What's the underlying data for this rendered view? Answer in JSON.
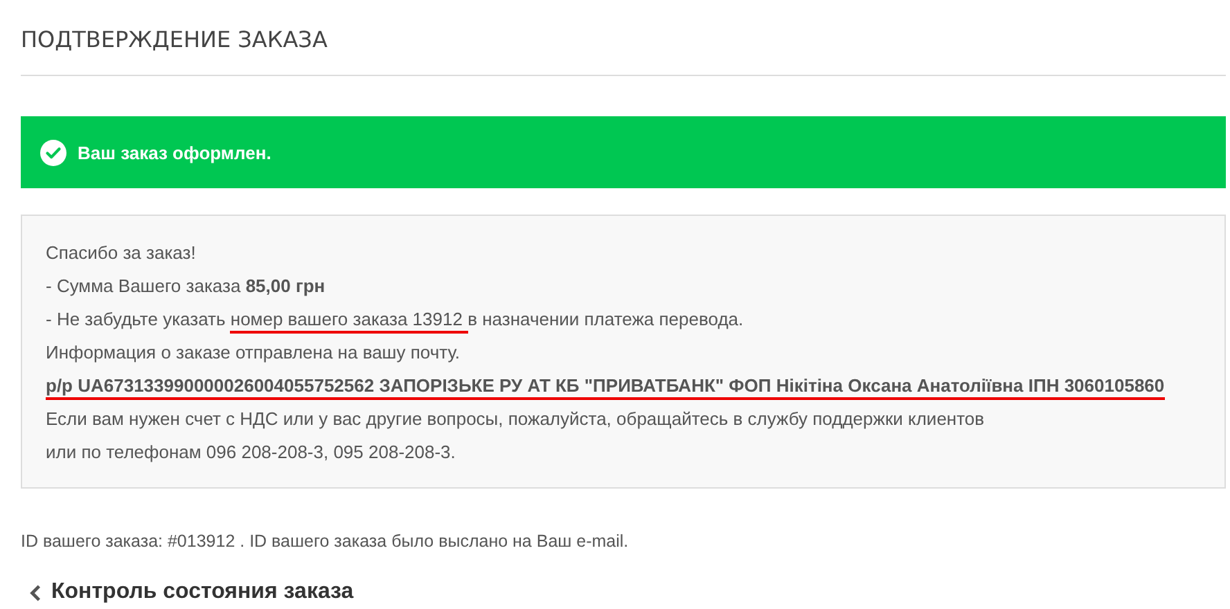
{
  "page_title": "ПОДТВЕРЖДЕНИЕ ЗАКАЗА",
  "alert": {
    "kind": "success",
    "text": "Ваш заказ оформлен."
  },
  "info_lines": [
    [
      {
        "text": "Спасибо за заказ!",
        "bold": false,
        "underlined": false
      }
    ],
    [
      {
        "text": "- Сумма Вашего заказа ",
        "bold": false,
        "underlined": false
      },
      {
        "text": "85,00 грн",
        "bold": true,
        "underlined": false
      }
    ],
    [
      {
        "text": "- Не забудьте указать ",
        "bold": false,
        "underlined": false
      },
      {
        "text": "номер вашего заказа 13912 ",
        "bold": false,
        "underlined": true
      },
      {
        "text": "в назначении платежа перевода.",
        "bold": false,
        "underlined": false
      }
    ],
    [
      {
        "text": "Информация о заказе отправлена на вашу почту.",
        "bold": false,
        "underlined": false
      }
    ],
    [
      {
        "text": "р/р UA673133990000026004055752562 ЗАПОРІЗЬКЕ РУ АТ КБ \"ПРИВАТБАНК\" ФОП Нікітіна Оксана Анатоліївна ІПН 3060105860",
        "bold": true,
        "underlined": true
      }
    ],
    [
      {
        "text": "Если вам нужен счет с НДС или у вас другие вопросы, пожалуйста, обращайтесь в службу поддержки клиентов",
        "bold": false,
        "underlined": false
      }
    ],
    [
      {
        "text": "или по телефонам 096 208-208-3, 095 208-208-3.",
        "bold": false,
        "underlined": false
      }
    ]
  ],
  "order_id_note": "ID вашего заказа: #013912 . ID вашего заказа было выслано на Ваш e-mail.",
  "back_link": "Контроль состояния заказа"
}
